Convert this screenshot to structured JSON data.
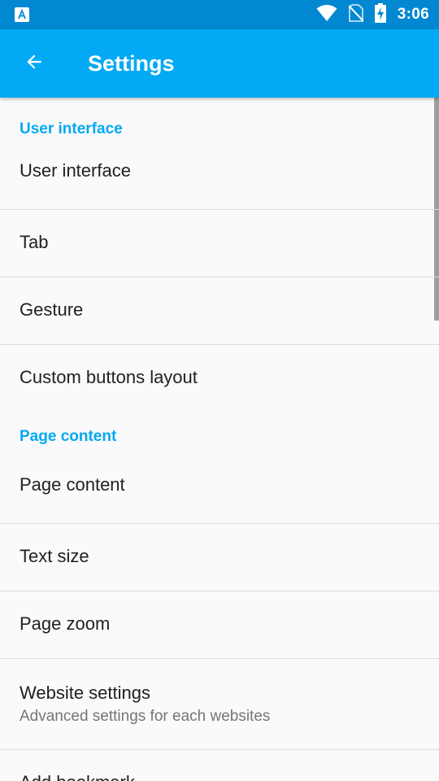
{
  "status_bar": {
    "time": "3:06",
    "icons": [
      "notification-a-icon",
      "wifi-icon",
      "no-sim-icon",
      "battery-charging-icon"
    ]
  },
  "appbar": {
    "title": "Settings",
    "back_icon": "arrow-back-icon"
  },
  "sections": [
    {
      "header": "User interface",
      "items": [
        {
          "title": "User interface"
        },
        {
          "title": "Tab"
        },
        {
          "title": "Gesture"
        },
        {
          "title": "Custom buttons layout"
        }
      ]
    },
    {
      "header": "Page content",
      "items": [
        {
          "title": "Page content"
        },
        {
          "title": "Text size"
        },
        {
          "title": "Page zoom"
        },
        {
          "title": "Website settings",
          "summary": "Advanced settings for each websites"
        },
        {
          "title": "Add bookmark"
        }
      ]
    }
  ],
  "colors": {
    "status_bar": "#0288d1",
    "app_bar": "#03a9f4",
    "accent": "#03a9f4",
    "background": "#fafafa",
    "divider": "#dcdcdc"
  }
}
